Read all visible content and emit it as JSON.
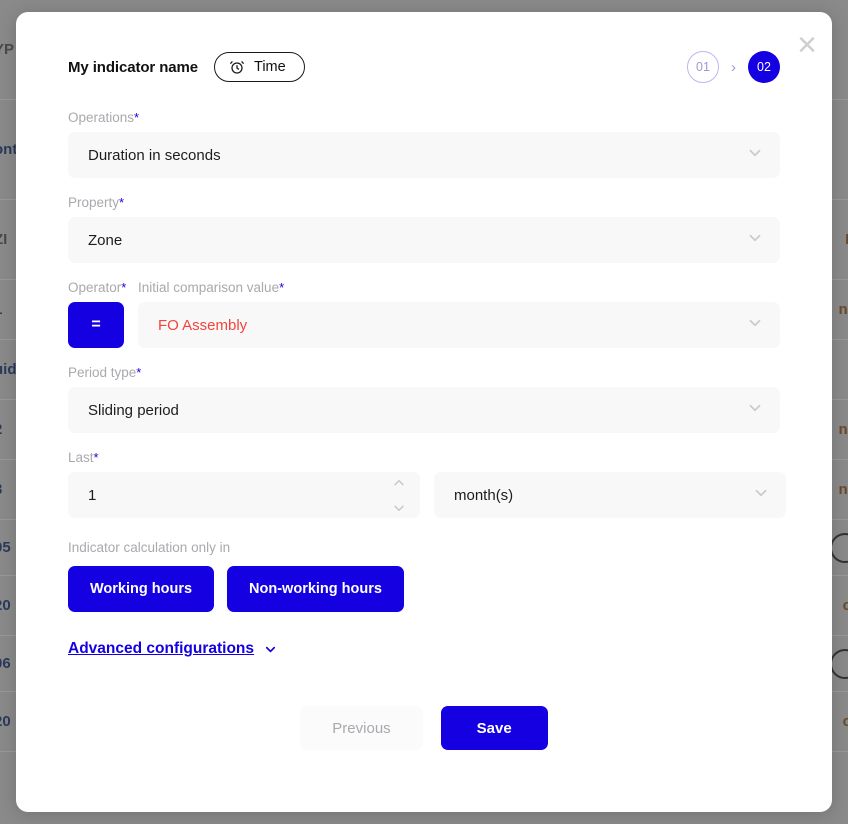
{
  "background": {
    "rows": [
      {
        "left": "YP",
        "right": ""
      },
      {
        "left": "ont",
        "right": ""
      },
      {
        "left": "",
        "right": ""
      },
      {
        "left": "",
        "right": ""
      },
      {
        "left": "ZI",
        "right": "N"
      },
      {
        "left": "1",
        "right": "ne"
      },
      {
        "left": "uid",
        "right": "-"
      },
      {
        "left": "2",
        "right": "ne"
      },
      {
        "left": "3",
        "right": "ne"
      },
      {
        "left": "05",
        "right": ""
      },
      {
        "left": "20",
        "right": "ct"
      },
      {
        "left": "06",
        "right": ""
      },
      {
        "left": "20",
        "right": "ct"
      }
    ]
  },
  "modal": {
    "close_label": "×",
    "header": {
      "indicator_name": "My indicator name",
      "type_pill": {
        "label": "Time",
        "icon": "alarm-clock-icon"
      },
      "steps": [
        {
          "label": "01",
          "state": "inactive"
        },
        {
          "label": "02",
          "state": "active"
        }
      ],
      "step_separator": "›"
    },
    "fields": {
      "operations": {
        "label": "Operations",
        "required": "*",
        "value": "Duration in seconds"
      },
      "property": {
        "label": "Property",
        "required": "*",
        "value": "Zone"
      },
      "operator": {
        "label": "Operator",
        "required": "*",
        "value": "="
      },
      "initial_comparison_value": {
        "label": "Initial comparison value",
        "required": "*",
        "value": "FO Assembly"
      },
      "period_type": {
        "label": "Period type",
        "required": "*",
        "value": "Sliding period"
      },
      "last": {
        "label": "Last",
        "required": "*",
        "value": "1"
      },
      "last_unit": {
        "value": "month(s)"
      }
    },
    "hours": {
      "label": "Indicator calculation only in",
      "working": "Working hours",
      "non_working": "Non-working hours"
    },
    "advanced": {
      "label": "Advanced configurations"
    },
    "footer": {
      "previous": "Previous",
      "save": "Save"
    }
  },
  "colors": {
    "accent_blue": "#1400e0",
    "value_red": "#f1453d",
    "step_inactive": "#9d97d6",
    "field_bg": "#f8f8f9",
    "label_gray": "#a9a9ae"
  }
}
